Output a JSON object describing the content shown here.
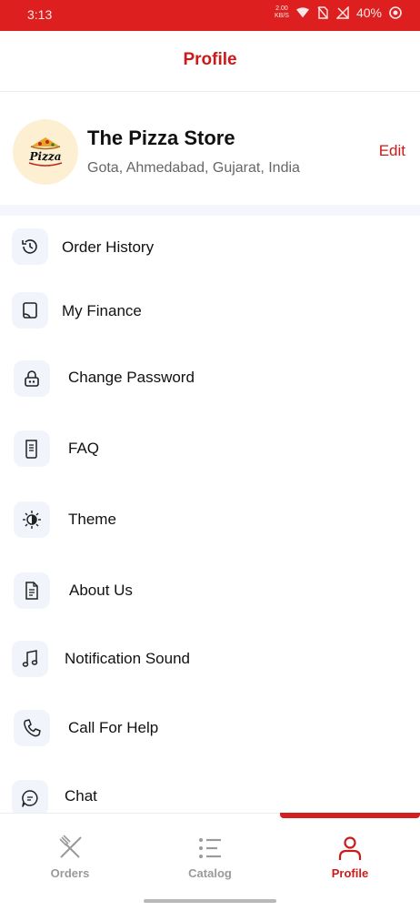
{
  "status_bar": {
    "time": "3:13",
    "net_rate_top": "2.00",
    "net_rate_bottom": "KB/S",
    "battery": "40%"
  },
  "header": {
    "title": "Profile"
  },
  "store": {
    "logo_text": "Pizza",
    "name": "The Pizza Store",
    "location": "Gota, Ahmedabad, Gujarat, India",
    "edit_label": "Edit"
  },
  "menu": {
    "items": [
      {
        "label": "Order History",
        "icon": "history-icon"
      },
      {
        "label": "My Finance",
        "icon": "wallet-icon"
      },
      {
        "label": "Change Password",
        "icon": "lock-icon"
      },
      {
        "label": "FAQ",
        "icon": "scroll-icon"
      },
      {
        "label": "Theme",
        "icon": "theme-icon"
      },
      {
        "label": "About Us",
        "icon": "document-icon"
      },
      {
        "label": "Notification Sound",
        "icon": "music-note-icon"
      },
      {
        "label": "Call For Help",
        "icon": "phone-icon"
      },
      {
        "label": "Chat",
        "icon": "chat-icon"
      }
    ]
  },
  "bottom_nav": {
    "items": [
      {
        "label": "Orders",
        "icon": "fork-knife-icon"
      },
      {
        "label": "Catalog",
        "icon": "list-icon"
      },
      {
        "label": "Profile",
        "icon": "user-icon"
      }
    ],
    "active": "Profile"
  },
  "colors": {
    "brand_red": "#cc1a1a",
    "status_bar": "#dd1f1f",
    "icon_bg": "#f1f4fa",
    "logo_bg": "#fdf0d2"
  }
}
